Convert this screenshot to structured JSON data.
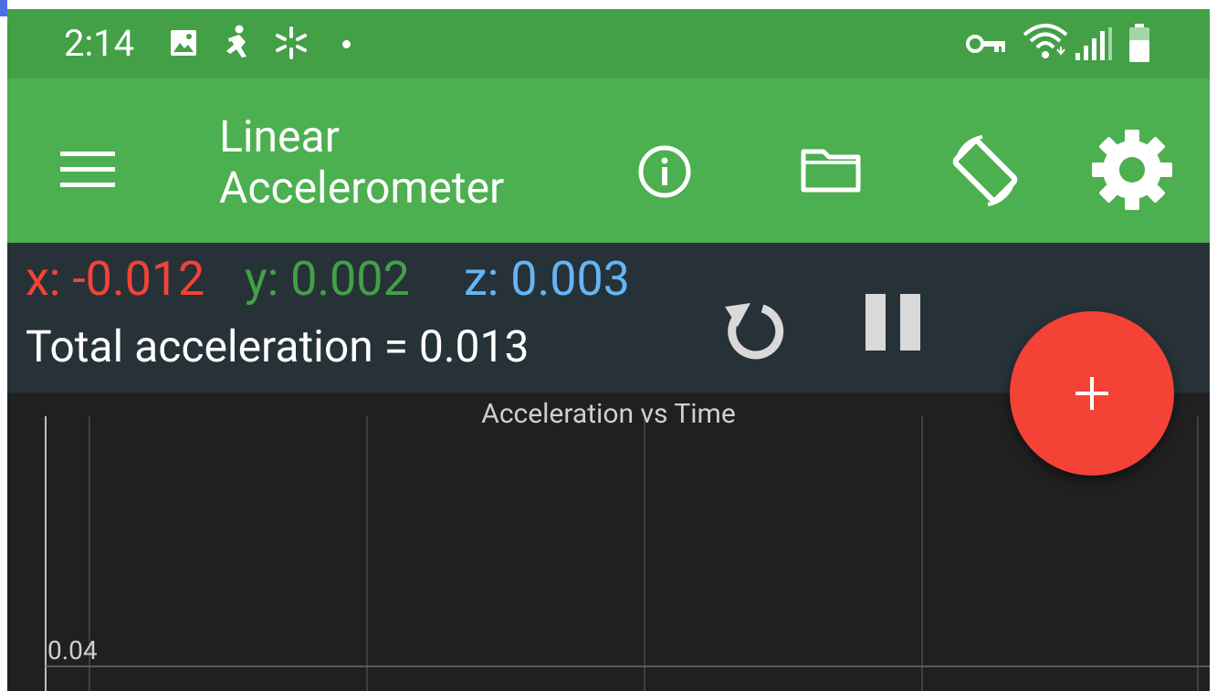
{
  "status_bar": {
    "time": "2:14",
    "left_icons": [
      "image-icon",
      "fitness-icon",
      "asterisk-icon",
      "dot-icon"
    ],
    "right_icons": [
      "vpn-key-icon",
      "wifi-icon",
      "signal-icon",
      "battery-icon"
    ]
  },
  "app_bar": {
    "title": "Linear\nAccelerometer",
    "title_line1": "Linear",
    "title_line2": "Accelerometer",
    "actions": [
      "menu-icon",
      "info-icon",
      "folder-icon",
      "screen-rotation-icon",
      "settings-icon"
    ]
  },
  "readout": {
    "x": "x: -0.012",
    "y": "y: 0.002",
    "z": "z: 0.003",
    "total": "Total acceleration = 0.013",
    "buttons": [
      "reset-icon",
      "pause-icon"
    ]
  },
  "chart": {
    "title": "Acceleration vs Time",
    "y_tick": "0.04"
  },
  "chart_data": {
    "type": "line",
    "title": "Acceleration vs Time",
    "xlabel": "",
    "ylabel": "",
    "y_ticks": [
      "0.04"
    ],
    "series": [],
    "grid": true
  },
  "fab": {
    "icon": "plus-icon"
  },
  "colors": {
    "status_bar": "#43a047",
    "app_bar": "#4caf50",
    "readout_bg": "#263238",
    "chart_bg": "#202020",
    "x": "#f44336",
    "y": "#43a047",
    "z": "#64b5f6",
    "fab": "#f44336"
  }
}
